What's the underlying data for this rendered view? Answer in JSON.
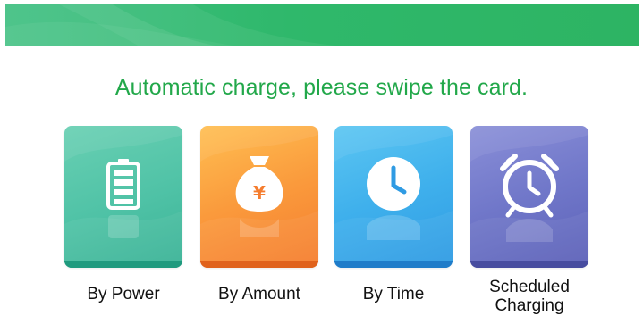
{
  "prompt": "Automatic charge, please swipe the card.",
  "options": [
    {
      "label_line1": "By Power",
      "label_line2": "",
      "icon": "battery-icon"
    },
    {
      "label_line1": "By Amount",
      "label_line2": "",
      "icon": "money-bag-icon"
    },
    {
      "label_line1": "By Time",
      "label_line2": "",
      "icon": "clock-icon"
    },
    {
      "label_line1": "Scheduled",
      "label_line2": "Charging",
      "icon": "alarm-clock-icon"
    }
  ],
  "currency_symbol": "¥",
  "colors": {
    "banner": "#2fb86b",
    "prompt_text": "#22a84a",
    "power_tile": "#4fc2a6",
    "amount_tile": "#fa9a3c",
    "time_tile": "#3fb0ec",
    "scheduled_tile": "#7077c9"
  }
}
